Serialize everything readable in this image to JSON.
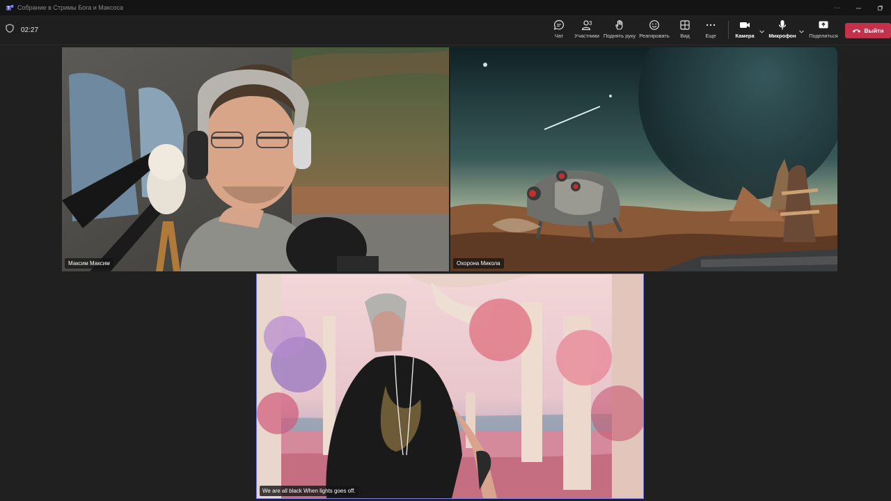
{
  "window": {
    "title": "Собрание в Стримы Бога и Максоса",
    "controls": [
      "more-icon",
      "minimize-icon",
      "restore-icon"
    ]
  },
  "toolbar": {
    "timer": "02:27",
    "chat_label": "Чат",
    "participants_label": "Участники",
    "participants_count": "3",
    "raise_hand_label": "Поднять руку",
    "react_label": "Реагировать",
    "view_label": "Вид",
    "more_label": "Еще",
    "camera_label": "Камера",
    "mic_label": "Микрофон",
    "share_label": "Поделиться",
    "leave_label": "Выйти",
    "leave_color": "#c4314b"
  },
  "participants": [
    {
      "name": "Максим Максим"
    },
    {
      "name": "Охорона Микола"
    },
    {
      "caption": "We are all black When lights goes off."
    }
  ],
  "colors": {
    "active_speaker": "#7b83eb",
    "background": "#202020"
  }
}
